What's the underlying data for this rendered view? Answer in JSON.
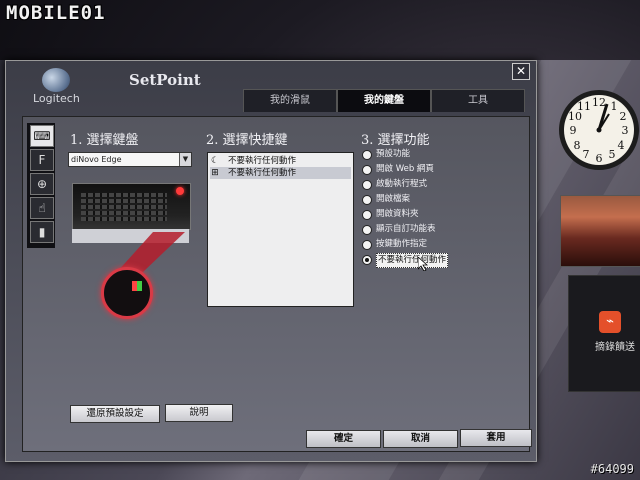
{
  "watermark": {
    "logo": "MOBILE01",
    "id": "#64099"
  },
  "window": {
    "brand": "Logitech",
    "title": "SetPoint",
    "close_label": "✕",
    "tabs": [
      {
        "label": "我的滑鼠",
        "active": false
      },
      {
        "label": "我的鍵盤",
        "active": true
      },
      {
        "label": "工具",
        "active": false
      }
    ]
  },
  "sidebar": {
    "icons": [
      "keyboard-shortcut-icon",
      "f-key-icon",
      "zoom-icon",
      "touch-icon",
      "battery-icon"
    ]
  },
  "step1": {
    "title": "1. 選擇鍵盤",
    "keyboard_select": "diNovo Edge"
  },
  "step2": {
    "title": "2. 選擇快捷鍵",
    "items": [
      {
        "icon": "moon-icon",
        "glyph": "☾",
        "label": "不要執行任何動作",
        "selected": false
      },
      {
        "icon": "windows-key-icon",
        "glyph": "⊞",
        "label": "不要執行任何動作",
        "selected": true
      }
    ]
  },
  "step3": {
    "title": "3. 選擇功能",
    "options": [
      {
        "label": "預設功能",
        "checked": false
      },
      {
        "label": "開啟 Web 網頁",
        "checked": false
      },
      {
        "label": "啟動執行程式",
        "checked": false
      },
      {
        "label": "開啟檔案",
        "checked": false
      },
      {
        "label": "開啟資料夾",
        "checked": false
      },
      {
        "label": "顯示自訂功能表",
        "checked": false
      },
      {
        "label": "按鍵動作指定",
        "checked": false
      },
      {
        "label": "不要執行任何動作",
        "checked": true
      }
    ]
  },
  "buttons": {
    "restore_defaults": "還原預設設定",
    "help": "說明",
    "ok": "確定",
    "cancel": "取消",
    "apply": "套用"
  },
  "desktop": {
    "feed_label": "摘錄饋送"
  }
}
